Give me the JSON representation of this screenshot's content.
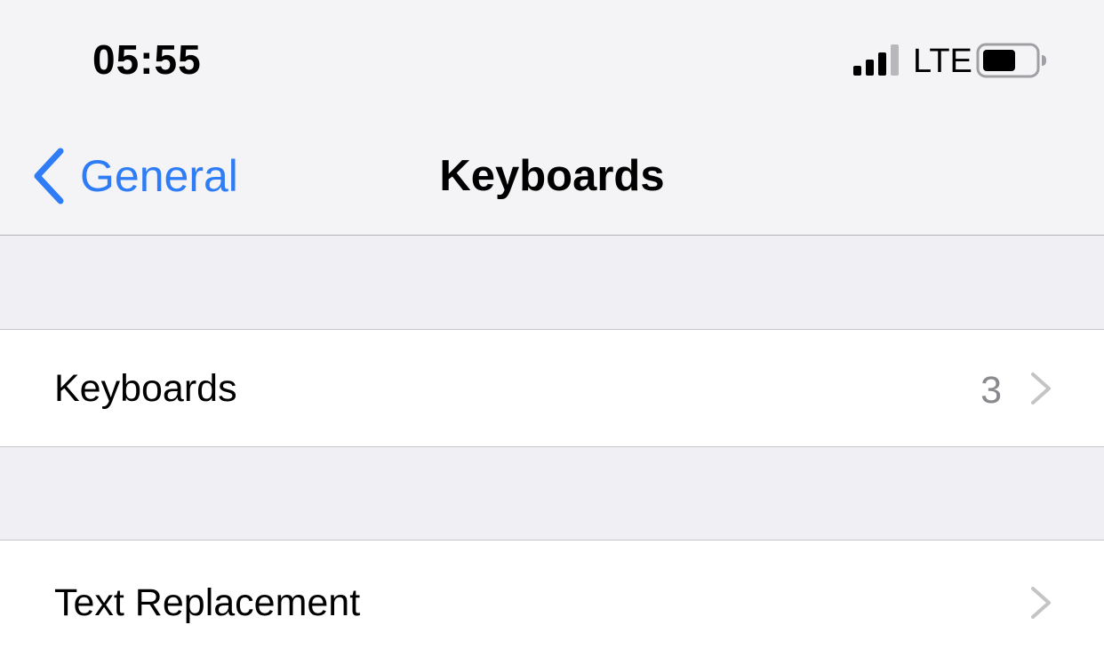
{
  "status_bar": {
    "time": "05:55",
    "network": "LTE",
    "signal_icon": "cellular-signal-icon",
    "battery_icon": "battery-icon"
  },
  "nav": {
    "back_label": "General",
    "back_icon": "chevron-left-icon",
    "title": "Keyboards"
  },
  "rows": [
    {
      "label": "Keyboards",
      "value": "3",
      "icon": "chevron-right-icon"
    },
    {
      "label": "Text Replacement",
      "value": "",
      "icon": "chevron-right-icon"
    }
  ],
  "colors": {
    "accent": "#2f7df6",
    "background": "#efeff4",
    "bar": "#f4f4f6",
    "secondary_text": "#8a8a8e"
  }
}
